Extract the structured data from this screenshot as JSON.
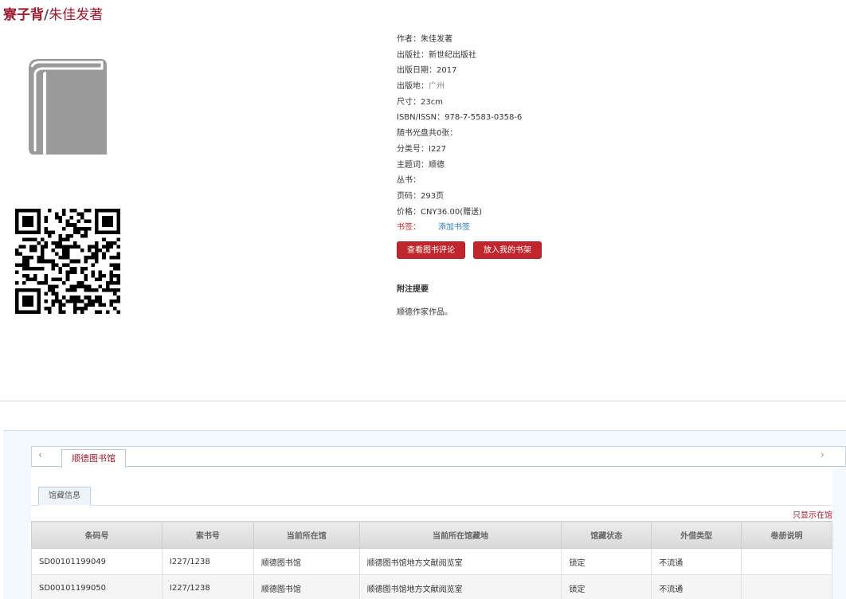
{
  "title": {
    "book": "寮子背",
    "separator": "/",
    "author": "朱佳发著"
  },
  "details": [
    {
      "label": "作者：",
      "value": "朱佳发著",
      "muted": false
    },
    {
      "label": "出版社：",
      "value": "新世纪出版社",
      "muted": false
    },
    {
      "label": "出版日期：",
      "value": "2017",
      "muted": false
    },
    {
      "label": "出版地：",
      "value": "广州",
      "muted": true
    },
    {
      "label": "尺寸：",
      "value": "23cm",
      "muted": false
    },
    {
      "label": "ISBN/ISSN：",
      "value": "978-7-5583-0358-6",
      "muted": false
    },
    {
      "label": "随书光盘共0张：",
      "value": "",
      "muted": false
    },
    {
      "label": "分类号：",
      "value": "I227",
      "muted": false
    },
    {
      "label": "主题词：",
      "value": "顺德",
      "muted": false
    },
    {
      "label": "丛书：",
      "value": "",
      "muted": false
    },
    {
      "label": "页码：",
      "value": "293页",
      "muted": false
    },
    {
      "label": "价格：",
      "value": "CNY36.00(赠送)",
      "muted": false
    }
  ],
  "bookmark": {
    "label": "书签：",
    "add_link": "添加书签"
  },
  "actions": {
    "view_reviews": "查看图书评论",
    "add_to_shelf": "放入我的书架"
  },
  "notes": {
    "heading": "附注提要",
    "body": "顺德作家作品。"
  },
  "library_tabs": {
    "prev": "‹",
    "next": "›",
    "active": "顺德图书馆"
  },
  "holdings": {
    "tab": "馆藏信息",
    "only_in_library": "只显示在馆",
    "columns": [
      "条码号",
      "索书号",
      "当前所在馆",
      "当前所在馆藏地",
      "馆藏状态",
      "外借类型",
      "卷册说明"
    ],
    "rows": [
      [
        "SD00101199049",
        "I227/1238",
        "顺德图书馆",
        "顺德图书馆地方文献阅览室",
        "锁定",
        "不流通",
        ""
      ],
      [
        "SD00101199050",
        "I227/1238",
        "顺德图书馆",
        "顺德图书馆地方文献阅览室",
        "锁定",
        "不流通",
        ""
      ]
    ]
  },
  "colors": {
    "brand_red": "#9b1b2e",
    "button_red": "#c0272d",
    "link_blue": "#2b7bb8"
  }
}
